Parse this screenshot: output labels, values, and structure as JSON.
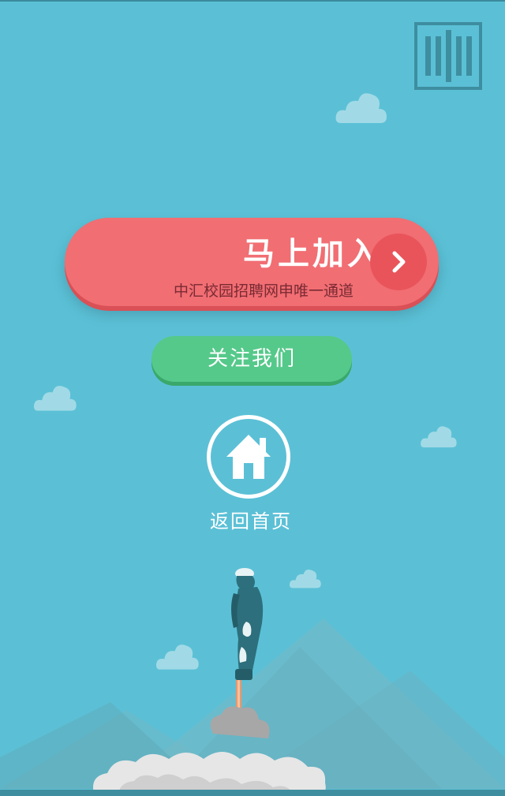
{
  "join": {
    "title": "马上加入",
    "subtitle": "中汇校园招聘网申唯一通道"
  },
  "follow": {
    "label": "关注我们"
  },
  "home": {
    "label": "返回首页"
  },
  "icons": {
    "logo": "barcode-logo-icon",
    "arrow": "chevron-right-icon",
    "home": "house-icon"
  },
  "colors": {
    "background": "#5bc0d6",
    "join_button": "#f16e73",
    "follow_button": "#55c98a",
    "logo": "#3e8ea0"
  }
}
